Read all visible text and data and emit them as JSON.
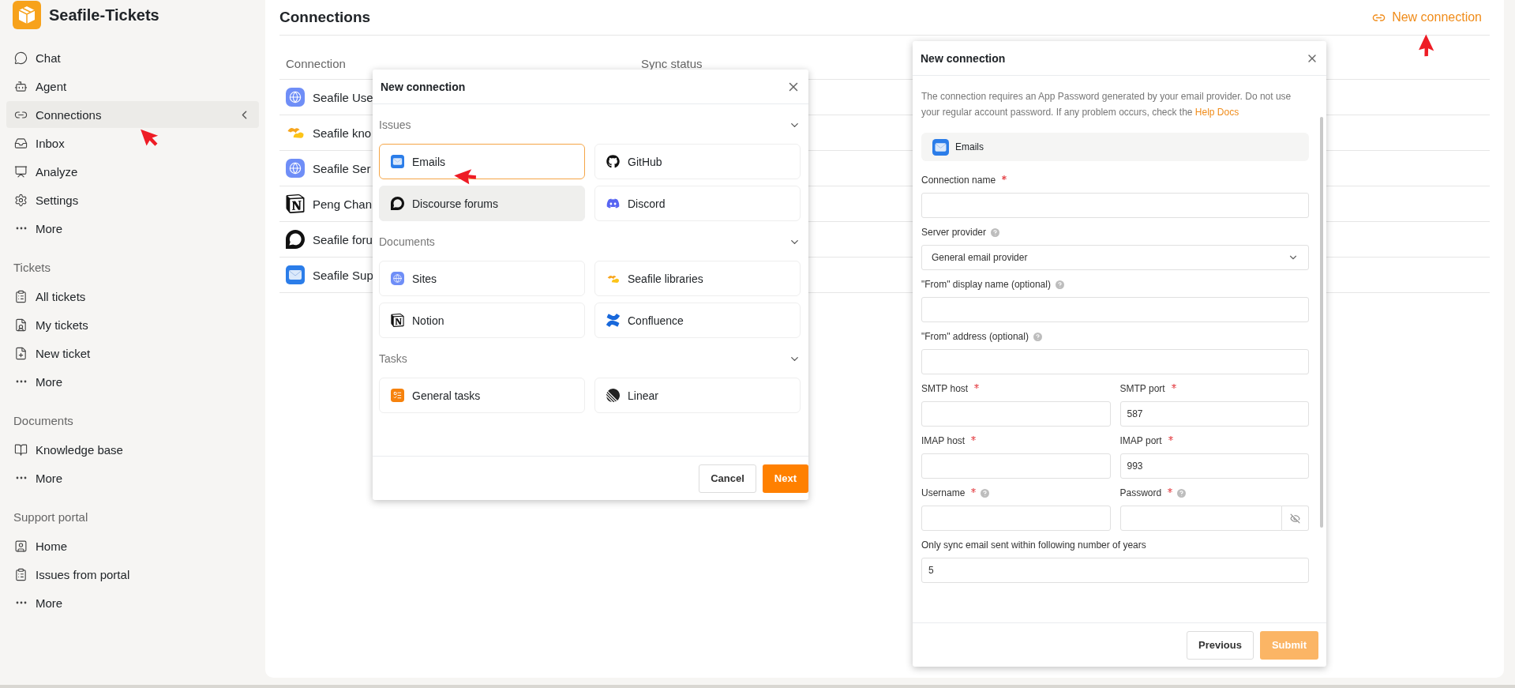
{
  "app": {
    "name": "Seafile-Tickets"
  },
  "sidebar": {
    "groups": [
      {
        "items": [
          {
            "label": "Chat",
            "selected": false
          },
          {
            "label": "Agent",
            "selected": false
          },
          {
            "label": "Connections",
            "selected": true
          },
          {
            "label": "Inbox",
            "selected": false
          },
          {
            "label": "Analyze",
            "selected": false
          },
          {
            "label": "Settings",
            "selected": false
          },
          {
            "label": "More",
            "selected": false
          }
        ]
      },
      {
        "title": "Tickets",
        "items": [
          {
            "label": "All tickets",
            "selected": false
          },
          {
            "label": "My tickets",
            "selected": false
          },
          {
            "label": "New ticket",
            "selected": false
          },
          {
            "label": "More",
            "selected": false
          }
        ]
      },
      {
        "title": "Documents",
        "items": [
          {
            "label": "Knowledge base",
            "selected": false
          },
          {
            "label": "More",
            "selected": false
          }
        ]
      },
      {
        "title": "Support portal",
        "items": [
          {
            "label": "Home",
            "selected": false
          },
          {
            "label": "Issues from portal",
            "selected": false
          },
          {
            "label": "More",
            "selected": false
          }
        ]
      }
    ]
  },
  "page": {
    "title": "Connections",
    "new_connection": "New connection"
  },
  "table": {
    "columns": [
      "Connection",
      "Sync status"
    ],
    "rows": [
      {
        "kind": "site",
        "name": "Seafile Use"
      },
      {
        "kind": "seafile",
        "name": "Seafile kno"
      },
      {
        "kind": "site",
        "name": "Seafile Ser"
      },
      {
        "kind": "notion",
        "name": "Peng Chan"
      },
      {
        "kind": "discourse",
        "name": "Seafile foru"
      },
      {
        "kind": "email",
        "name": "Seafile Sup"
      }
    ]
  },
  "picker": {
    "title": "New connection",
    "sections": [
      {
        "title": "Issues",
        "expanded": true,
        "items": [
          {
            "kind": "email",
            "label": "Emails",
            "selected": true,
            "hovered": false
          },
          {
            "kind": "github",
            "label": "GitHub",
            "selected": false,
            "hovered": false
          },
          {
            "kind": "discourse",
            "label": "Discourse forums",
            "selected": false,
            "hovered": true
          },
          {
            "kind": "discord",
            "label": "Discord",
            "selected": false,
            "hovered": false
          }
        ]
      },
      {
        "title": "Documents",
        "expanded": true,
        "items": [
          {
            "kind": "site",
            "label": "Sites",
            "selected": false,
            "hovered": false
          },
          {
            "kind": "seafile",
            "label": "Seafile libraries",
            "selected": false,
            "hovered": false
          },
          {
            "kind": "notion",
            "label": "Notion",
            "selected": false,
            "hovered": false
          },
          {
            "kind": "confluence",
            "label": "Confluence",
            "selected": false,
            "hovered": false
          }
        ]
      },
      {
        "title": "Tasks",
        "expanded": true,
        "items": [
          {
            "kind": "tasks",
            "label": "General tasks",
            "selected": false,
            "hovered": false
          },
          {
            "kind": "linear",
            "label": "Linear",
            "selected": false,
            "hovered": false
          }
        ]
      }
    ],
    "buttons": [
      {
        "label": "Cancel",
        "primary": false,
        "disabled": false
      },
      {
        "label": "Next",
        "primary": true,
        "disabled": false
      }
    ]
  },
  "form": {
    "title": "New connection",
    "notice": "The connection requires an App Password generated by your email provider. Do not use your regular account password. If any problem occurs, check the",
    "link": "Help Docs",
    "source": {
      "kind": "email",
      "label": "Emails"
    },
    "rows": [
      [
        {
          "kind": "text",
          "label": "Connection name",
          "required": true,
          "help": false
        }
      ],
      [
        {
          "kind": "select",
          "label": "Server provider",
          "required": false,
          "help": true,
          "value": "General email provider"
        }
      ],
      [
        {
          "kind": "text",
          "label": "\"From\" display name (optional)",
          "required": false,
          "help": true
        }
      ],
      [
        {
          "kind": "text",
          "label": "\"From\" address (optional)",
          "required": false,
          "help": true
        }
      ],
      [
        {
          "kind": "text",
          "label": "SMTP host",
          "required": true,
          "help": false
        },
        {
          "kind": "text",
          "label": "SMTP port",
          "required": true,
          "help": false,
          "value": "587"
        }
      ],
      [
        {
          "kind": "text",
          "label": "IMAP host",
          "required": true,
          "help": false
        },
        {
          "kind": "text",
          "label": "IMAP port",
          "required": true,
          "help": false,
          "value": "993"
        }
      ],
      [
        {
          "kind": "text",
          "label": "Username",
          "required": true,
          "help": true
        },
        {
          "kind": "password",
          "label": "Password",
          "required": true,
          "help": true
        }
      ],
      [
        {
          "kind": "text",
          "label": "Only sync email sent within following number of years",
          "required": false,
          "help": false,
          "value": "5"
        }
      ]
    ],
    "buttons": [
      {
        "label": "Previous",
        "primary": false,
        "disabled": false
      },
      {
        "label": "Submit",
        "primary": true,
        "disabled": true
      }
    ]
  }
}
